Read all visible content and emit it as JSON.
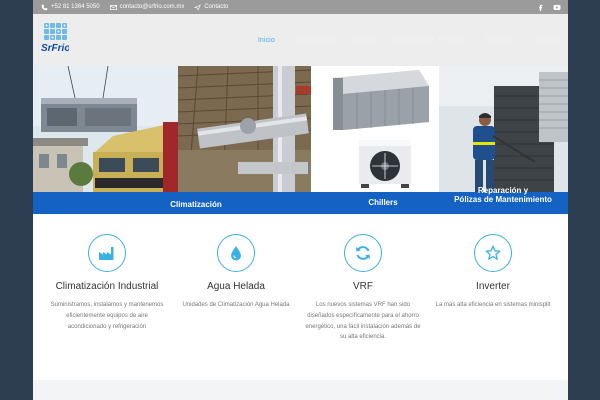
{
  "topbar": {
    "phone": "+52 81 1364 5050",
    "email": "contacto@srfrio.com.mx",
    "contact": "Contacto"
  },
  "logo": {
    "text": "SrFrio"
  },
  "nav": {
    "items": [
      "Inicio",
      "Climatizacion",
      "Chillers",
      "Sistema VRF e Inverter",
      "Servicios",
      "Contacto"
    ],
    "active_index": 0
  },
  "hero": {
    "label_1": "Climatización",
    "label_2": "Chillers",
    "label_3": "Reparación y\nPólizas de Mantenimiento"
  },
  "services": [
    {
      "icon": "factory-icon",
      "title": "Climatización Industrial",
      "text": "Suministramos, instalamos y mantenemos eficientemente equipos de aire acondicionado y refrigeración"
    },
    {
      "icon": "water-drop-icon",
      "title": "Agua Helada",
      "text": "Unidades de Climatización Agua Helada"
    },
    {
      "icon": "refresh-icon",
      "title": "VRF",
      "text": "Los nuevos sistemas VRF han sido diseñados específicamente para el ahorro energético, una fácil instalación además de su alta eficiencia."
    },
    {
      "icon": "star-icon",
      "title": "Inverter",
      "text": "La más alta eficiencia en sistemas minisplit"
    }
  ],
  "colors": {
    "accent": "#3bb0e6",
    "band": "#1462c4",
    "topbar": "#9b9b9b",
    "header": "#ededed",
    "outer": "#2d3e50"
  }
}
